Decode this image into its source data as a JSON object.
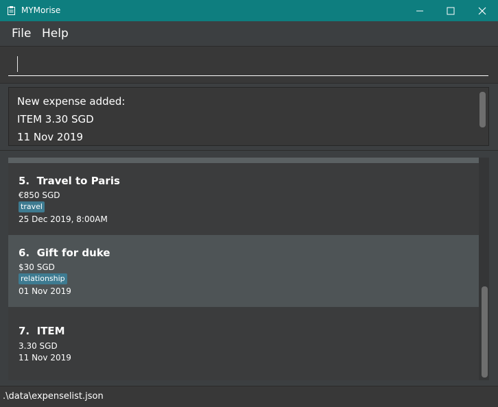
{
  "window": {
    "title": "MYMorise",
    "icon": "clipboard-icon",
    "titlebar_color": "#0e7e7f"
  },
  "menu": {
    "file": "File",
    "help": "Help"
  },
  "command": {
    "value": "",
    "placeholder": ""
  },
  "result": {
    "lines": [
      "New expense added:",
      "ITEM 3.30 SGD",
      "11 Nov 2019"
    ]
  },
  "expenses": [
    {
      "index": "5.",
      "title": "Travel to Paris",
      "amount": "€850 SGD",
      "tag": "travel",
      "date": "25 Dec 2019, 8:00AM"
    },
    {
      "index": "6.",
      "title": "Gift for duke",
      "amount": "$30 SGD",
      "tag": "relationship",
      "date": "01 Nov 2019"
    },
    {
      "index": "7.",
      "title": "ITEM",
      "amount": "3.30 SGD",
      "tag": "",
      "date": "11 Nov 2019"
    }
  ],
  "status": {
    "path": ".\\data\\expenselist.json"
  },
  "colors": {
    "background": "#3c3f41",
    "selected_card": "#4e5456",
    "tag": "#3e7b91"
  }
}
